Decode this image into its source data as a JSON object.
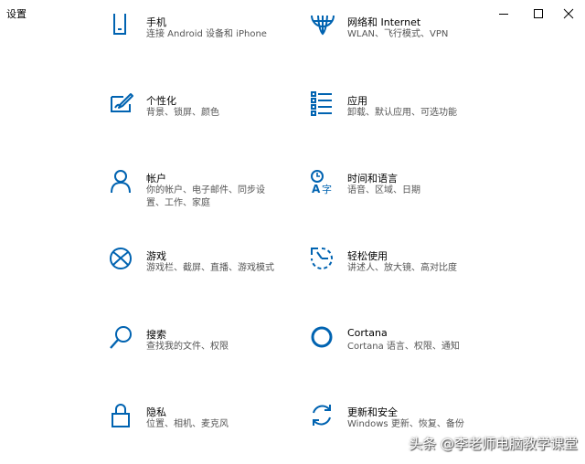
{
  "window": {
    "title": "设置"
  },
  "items": [
    {
      "key": "phone",
      "name": "手机",
      "desc": "连接 Android 设备和 iPhone",
      "icon": "phone-icon"
    },
    {
      "key": "network",
      "name": "网络和 Internet",
      "desc": "WLAN、飞行模式、VPN",
      "icon": "globe-icon"
    },
    {
      "key": "personalization",
      "name": "个性化",
      "desc": "背景、锁屏、颜色",
      "icon": "paint-brush-icon"
    },
    {
      "key": "apps",
      "name": "应用",
      "desc": "卸载、默认应用、可选功能",
      "icon": "app-list-icon"
    },
    {
      "key": "accounts",
      "name": "帐户",
      "desc": "你的帐户、电子邮件、同步设\n置、工作、家庭",
      "icon": "person-icon"
    },
    {
      "key": "time-language",
      "name": "时间和语言",
      "desc": "语音、区域、日期",
      "icon": "time-language-icon"
    },
    {
      "key": "gaming",
      "name": "游戏",
      "desc": "游戏栏、截屏、直播、游戏模式",
      "icon": "xbox-icon"
    },
    {
      "key": "ease-of-access",
      "name": "轻松使用",
      "desc": "讲述人、放大镜、高对比度",
      "icon": "ease-of-access-icon"
    },
    {
      "key": "search",
      "name": "搜索",
      "desc": "查找我的文件、权限",
      "icon": "search-icon"
    },
    {
      "key": "cortana",
      "name": "Cortana",
      "desc": "Cortana 语言、权限、通知",
      "icon": "cortana-icon"
    },
    {
      "key": "privacy",
      "name": "隐私",
      "desc": "位置、相机、麦克风",
      "icon": "lock-icon"
    },
    {
      "key": "update-security",
      "name": "更新和安全",
      "desc": "Windows 更新、恢复、备份",
      "icon": "refresh-icon"
    }
  ],
  "watermark": "头条 @李老师电脑教学课堂",
  "colors": {
    "accent": "#0063B1",
    "background": "#ffffff"
  }
}
